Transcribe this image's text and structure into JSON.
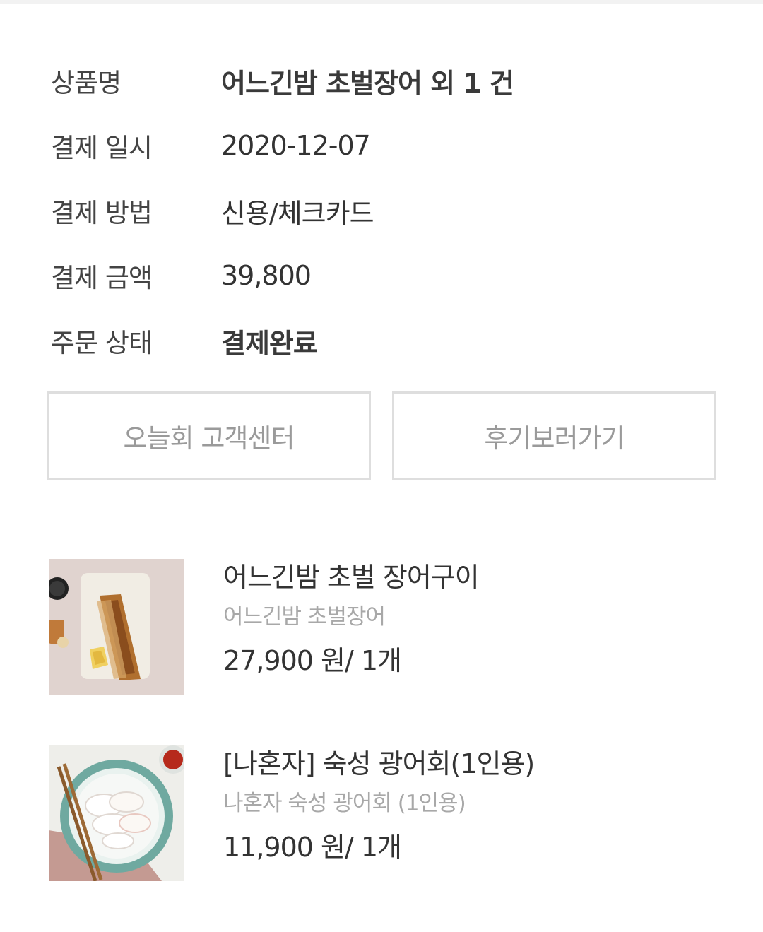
{
  "order_info": {
    "rows": [
      {
        "label": "상품명",
        "value": "어느긴밤 초벌장어 외 1 건"
      },
      {
        "label": "결제 일시",
        "value": "2020-12-07"
      },
      {
        "label": "결제 방법",
        "value": "신용/체크카드"
      },
      {
        "label": "결제 금액",
        "value": "39,800"
      },
      {
        "label": "주문 상태",
        "value": "결제완료"
      }
    ]
  },
  "buttons": {
    "customer_center": "오늘회 고객센터",
    "reviews": "후기보러가기"
  },
  "products": [
    {
      "name": "어느긴밤 초벌 장어구이",
      "option": "어느긴밤 초벌장어",
      "price_qty": "27,900 원/ 1개",
      "image": "grilled-eel-image"
    },
    {
      "name": "[나혼자] 숙성 광어회(1인용)",
      "option": "나혼자 숙성 광어회 (1인용)",
      "price_qty": "11,900 원/ 1개",
      "image": "flatfish-sashimi-image"
    }
  ]
}
